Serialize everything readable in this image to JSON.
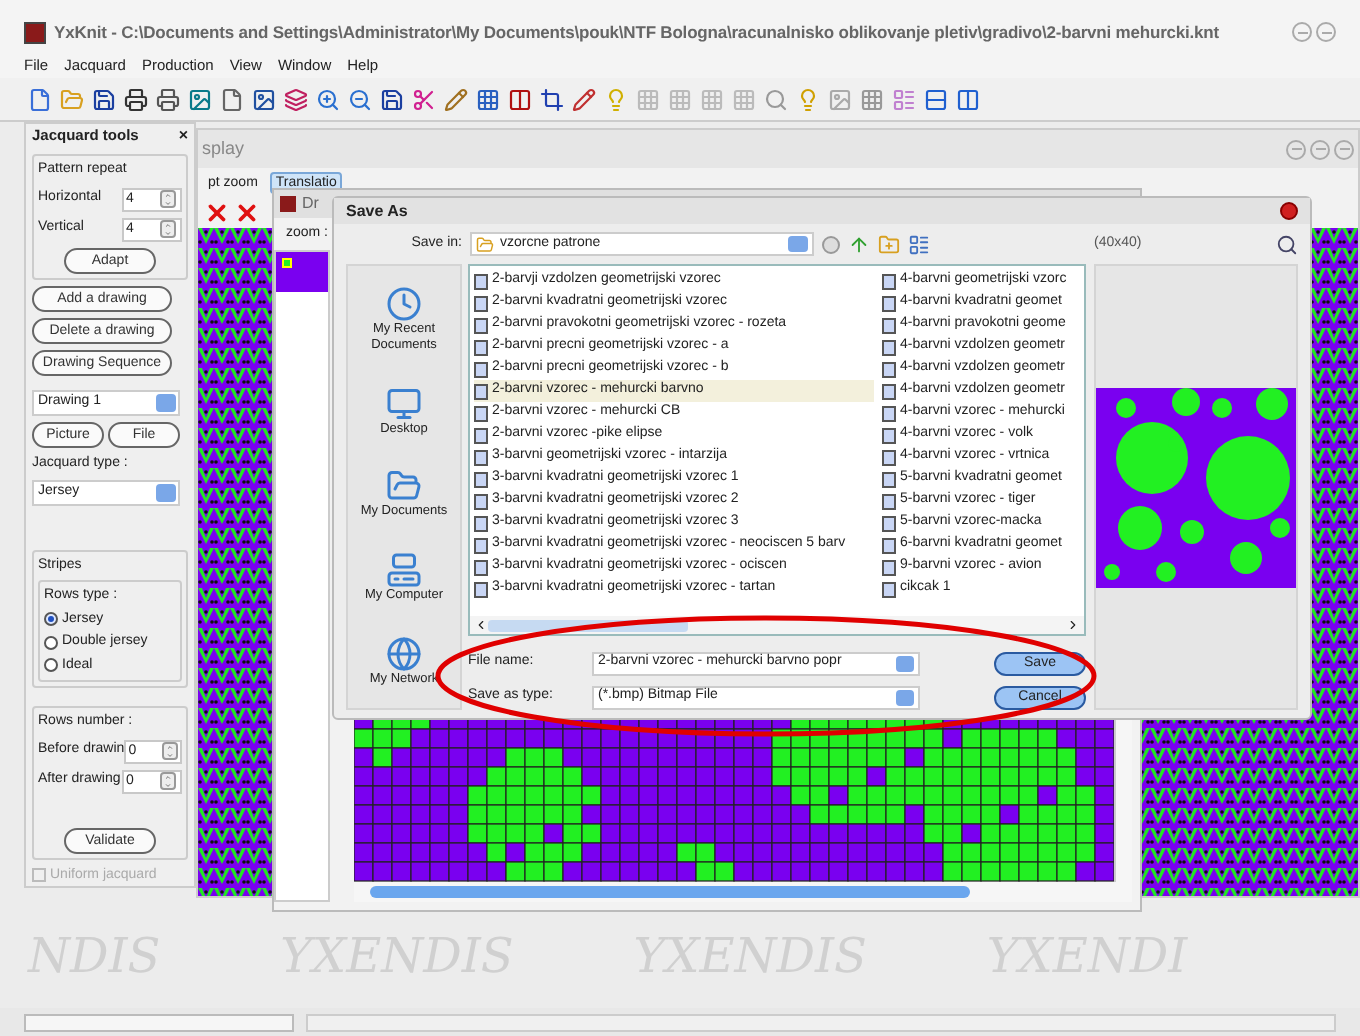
{
  "window": {
    "title": "YxKnit - C:\\Documents and Settings\\Administrator\\My Documents\\pouk\\NTF Bologna\\racunalnisko oblikovanje pletiv\\gradivo\\2-barvni mehurcki.knt"
  },
  "menu": [
    "File",
    "Jacquard",
    "Production",
    "View",
    "Window",
    "Help"
  ],
  "jacquard_tools": {
    "title": "Jacquard tools",
    "close": "×",
    "pattern_repeat": "Pattern repeat",
    "horizontal": {
      "label": "Horizontal",
      "value": "4"
    },
    "vertical": {
      "label": "Vertical",
      "value": "4"
    },
    "adapt": "Adapt",
    "buttons": [
      "Add a drawing",
      "Delete a drawing",
      "Drawing Sequence"
    ],
    "drawing": "Drawing 1",
    "picture": "Picture",
    "file": "File",
    "jacquard_type_label": "Jacquard type :",
    "jacquard_type": "Jersey",
    "stripes": "Stripes",
    "rows_type": "Rows type :",
    "options": [
      {
        "label": "Jersey",
        "selected": true
      },
      {
        "label": "Double jersey",
        "selected": false
      },
      {
        "label": "Ideal",
        "selected": false
      }
    ],
    "rows_number": "Rows number :",
    "before": {
      "label": "Before drawin",
      "value": "0"
    },
    "after": {
      "label": "After drawing",
      "value": "0"
    },
    "validate": "Validate",
    "uniform": {
      "label": "Uniform jacquard",
      "checked": false,
      "disabled": true
    }
  },
  "display_window": {
    "title": "splay",
    "tabs": [
      {
        "label": "pt zoom",
        "selected": false
      },
      {
        "label": "Translatio",
        "selected": true
      }
    ]
  },
  "drawing_window": {
    "title": "Dr",
    "zoom_label": "zoom :"
  },
  "save_as": {
    "title": "Save As",
    "save_in_label": "Save in:",
    "save_in": "vzorcne patrone",
    "preview_size": "(40x40)",
    "places": [
      "My Recent Documents",
      "Desktop",
      "My Documents",
      "My Computer",
      "My Network"
    ],
    "files_left": [
      {
        "name": "2-barvji vzdolzen geometrijski vzorec",
        "selected": false
      },
      {
        "name": "2-barvni kvadratni geometrijski vzorec",
        "selected": false
      },
      {
        "name": "2-barvni pravokotni geometrijski vzorec - rozeta",
        "selected": false
      },
      {
        "name": "2-barvni precni geometrijski vzorec - a",
        "selected": false
      },
      {
        "name": "2-barvni precni geometrijski vzorec - b",
        "selected": false
      },
      {
        "name": "2-barvni vzorec - mehurcki barvno",
        "selected": true
      },
      {
        "name": "2-barvni vzorec - mehurcki CB",
        "selected": false
      },
      {
        "name": "2-barvni vzorec -pike elipse",
        "selected": false
      },
      {
        "name": "3-barvni geometrijski vzorec - intarzija",
        "selected": false
      },
      {
        "name": "3-barvni kvadratni geometrijski vzorec 1",
        "selected": false
      },
      {
        "name": "3-barvni kvadratni geometrijski vzorec 2",
        "selected": false
      },
      {
        "name": "3-barvni kvadratni geometrijski vzorec 3",
        "selected": false
      },
      {
        "name": "3-barvni kvadratni geometrijski vzorec - neociscen 5 barv",
        "selected": false
      },
      {
        "name": "3-barvni kvadratni geometrijski vzorec - ociscen",
        "selected": false
      },
      {
        "name": "3-barvni kvadratni geometrijski vzorec - tartan",
        "selected": false
      }
    ],
    "files_right": [
      {
        "name": "4-barvni geometrijski vzorc",
        "selected": false
      },
      {
        "name": "4-barvni kvadratni geomet",
        "selected": false
      },
      {
        "name": "4-barvni pravokotni geome",
        "selected": false
      },
      {
        "name": "4-barvni vzdolzen geometr",
        "selected": false
      },
      {
        "name": "4-barvni vzdolzen geometr",
        "selected": false
      },
      {
        "name": "4-barvni vzdolzen geometr",
        "selected": false
      },
      {
        "name": "4-barvni vzorec - mehurcki",
        "selected": false
      },
      {
        "name": "4-barvni vzorec - volk",
        "selected": false
      },
      {
        "name": "4-barvni vzorec - vrtnica",
        "selected": false
      },
      {
        "name": "5-barvni kvadratni geomet",
        "selected": false
      },
      {
        "name": "5-barvni vzorec - tiger",
        "selected": false
      },
      {
        "name": "5-barvni vzorec-macka",
        "selected": false
      },
      {
        "name": "6-barvni kvadratni geomet",
        "selected": false
      },
      {
        "name": "9-barvni vzorec - avion",
        "selected": false
      },
      {
        "name": "cikcak 1",
        "selected": false
      }
    ],
    "file_name_label": "File name:",
    "file_name": "2-barvni vzorec - mehurcki barvno popr",
    "type_label": "Save as type:",
    "type": "(*.bmp) Bitmap File",
    "save": "Save",
    "cancel": "Cancel"
  },
  "background_logo": [
    "NDIS",
    "YXENDIS",
    "YXENDIS",
    "YXENDI"
  ]
}
